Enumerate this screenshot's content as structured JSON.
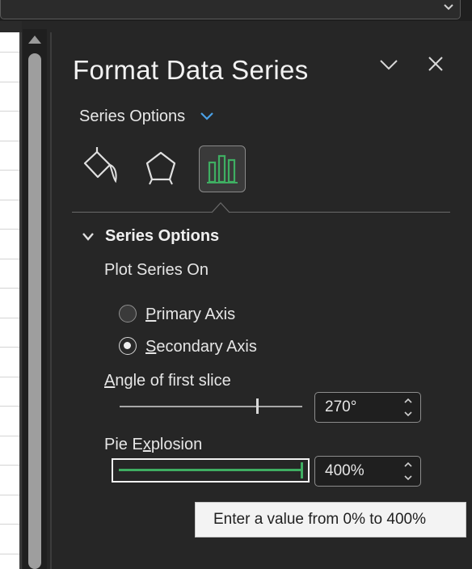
{
  "pane": {
    "title": "Format Data Series",
    "options_dropdown": "Series Options",
    "tabs": [
      {
        "name": "Fill & Line",
        "icon": "paint-bucket-icon"
      },
      {
        "name": "Effects",
        "icon": "pentagon-icon"
      },
      {
        "name": "Series Options",
        "icon": "bar-chart-icon",
        "selected": true
      }
    ]
  },
  "section": {
    "title": "Series Options",
    "plot_series_on_label": "Plot Series On",
    "primary_axis": {
      "prefix": "P",
      "rest": "rimary Axis",
      "selected": false
    },
    "secondary_axis": {
      "prefix": "S",
      "rest": "econdary Axis",
      "selected": true
    },
    "angle_label": {
      "prefix": "A",
      "rest": "ngle of first slice"
    },
    "angle_value": "270°",
    "angle_fraction": 0.75,
    "explosion_label": {
      "pre": "Pie E",
      "underlined": "x",
      "post": "plosion"
    },
    "explosion_value": "400%",
    "explosion_fraction": 1.0
  },
  "tooltip": {
    "text": "Enter a value from 0% to 400%"
  },
  "colors": {
    "accent_green": "#3fae62",
    "chevron_blue": "#4aa0e6",
    "pane_background": "#262626"
  }
}
